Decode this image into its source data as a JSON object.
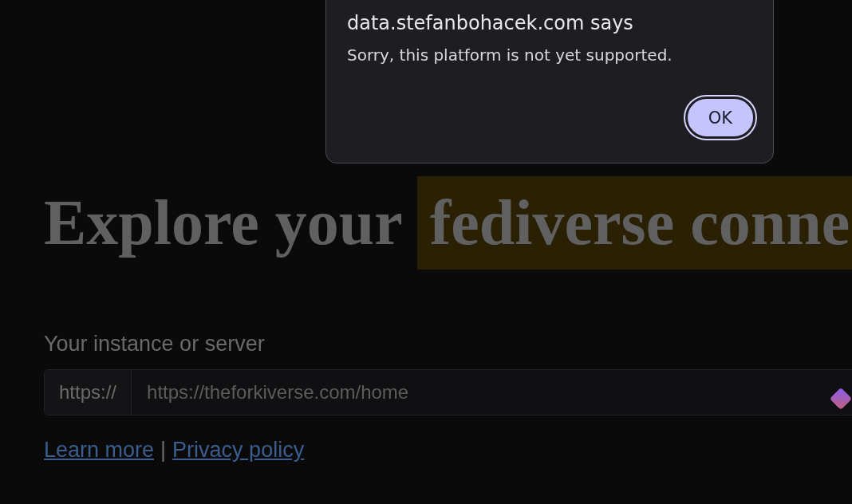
{
  "dialog": {
    "title": "data.stefanbohacek.com says",
    "message": "Sorry, this platform is not yet supported.",
    "button": "OK"
  },
  "heading": {
    "text": "Explore your",
    "highlight": "fediverse conne"
  },
  "form": {
    "label": "Your instance or server",
    "prefix": "https://",
    "placeholder": "https://theforkiverse.com/home"
  },
  "links": [
    {
      "text": "Learn more"
    },
    {
      "text": "Privacy policy"
    }
  ],
  "separator": "|"
}
